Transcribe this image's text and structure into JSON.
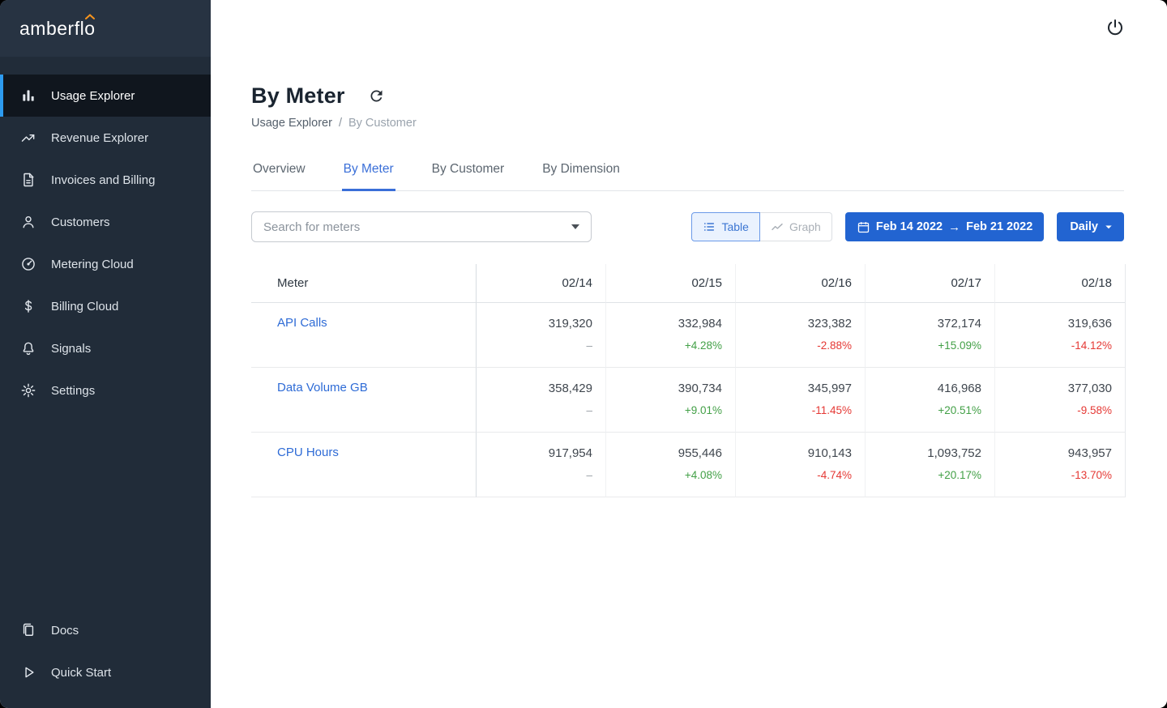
{
  "app": {
    "logo_prefix": "amberfl",
    "logo_last": "o",
    "accent_color": "#2264d1",
    "accent_bright": "#2d9bf0",
    "logo_hat_color": "#f7941d"
  },
  "sidebar": {
    "items": [
      {
        "label": "Usage Explorer",
        "icon": "bar-chart-icon",
        "active": true
      },
      {
        "label": "Revenue Explorer",
        "icon": "trending-up-icon",
        "active": false
      },
      {
        "label": "Invoices and Billing",
        "icon": "invoice-icon",
        "active": false
      },
      {
        "label": "Customers",
        "icon": "person-icon",
        "active": false
      },
      {
        "label": "Metering Cloud",
        "icon": "gauge-icon",
        "active": false
      },
      {
        "label": "Billing Cloud",
        "icon": "dollar-icon",
        "active": false
      },
      {
        "label": "Signals",
        "icon": "bell-icon",
        "active": false
      },
      {
        "label": "Settings",
        "icon": "gear-icon",
        "active": false
      }
    ],
    "footer_items": [
      {
        "label": "Docs",
        "icon": "docs-icon"
      },
      {
        "label": "Quick Start",
        "icon": "play-icon"
      }
    ]
  },
  "page": {
    "title": "By Meter",
    "breadcrumb": {
      "parent": "Usage Explorer",
      "separator": "/",
      "current": "By Customer"
    }
  },
  "tabs": [
    {
      "label": "Overview",
      "active": false
    },
    {
      "label": "By Meter",
      "active": true
    },
    {
      "label": "By Customer",
      "active": false
    },
    {
      "label": "By Dimension",
      "active": false
    }
  ],
  "controls": {
    "search": {
      "placeholder": "Search for meters"
    },
    "view_toggle": [
      {
        "label": "Table",
        "icon": "table-list-icon",
        "selected": true
      },
      {
        "label": "Graph",
        "icon": "line-chart-icon",
        "selected": false
      }
    ],
    "date_range": {
      "start": "Feb 14 2022",
      "arrow": "→",
      "end": "Feb 21 2022"
    },
    "granularity": {
      "label": "Daily"
    }
  },
  "table": {
    "meter_column_header": "Meter",
    "date_columns": [
      "02/14",
      "02/15",
      "02/16",
      "02/17",
      "02/18"
    ],
    "rows": [
      {
        "meter": "API Calls",
        "cells": [
          {
            "value": "319,320",
            "delta": "–",
            "trend": "none"
          },
          {
            "value": "332,984",
            "delta": "+4.28%",
            "trend": "up"
          },
          {
            "value": "323,382",
            "delta": "-2.88%",
            "trend": "down"
          },
          {
            "value": "372,174",
            "delta": "+15.09%",
            "trend": "up"
          },
          {
            "value": "319,636",
            "delta": "-14.12%",
            "trend": "down"
          }
        ]
      },
      {
        "meter": "Data Volume GB",
        "cells": [
          {
            "value": "358,429",
            "delta": "–",
            "trend": "none"
          },
          {
            "value": "390,734",
            "delta": "+9.01%",
            "trend": "up"
          },
          {
            "value": "345,997",
            "delta": "-11.45%",
            "trend": "down"
          },
          {
            "value": "416,968",
            "delta": "+20.51%",
            "trend": "up"
          },
          {
            "value": "377,030",
            "delta": "-9.58%",
            "trend": "down"
          }
        ]
      },
      {
        "meter": "CPU Hours",
        "cells": [
          {
            "value": "917,954",
            "delta": "–",
            "trend": "none"
          },
          {
            "value": "955,446",
            "delta": "+4.08%",
            "trend": "up"
          },
          {
            "value": "910,143",
            "delta": "-4.74%",
            "trend": "down"
          },
          {
            "value": "1,093,752",
            "delta": "+20.17%",
            "trend": "up"
          },
          {
            "value": "943,957",
            "delta": "-13.70%",
            "trend": "down"
          }
        ]
      }
    ],
    "colors": {
      "positive": "#43a047",
      "negative": "#e53935",
      "neutral": "#9aa0a6"
    }
  }
}
